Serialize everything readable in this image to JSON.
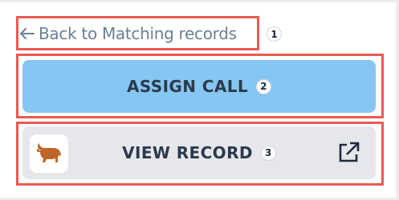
{
  "back_link": {
    "label": "Back to Matching records",
    "icon": "arrow-left-icon",
    "annotation": "1"
  },
  "assign_call": {
    "label": "ASSIGN CALL",
    "annotation": "2",
    "color": "#86c6f2"
  },
  "view_record": {
    "label": "VIEW RECORD",
    "annotation": "3",
    "logo_icon": "bull-logo-icon",
    "action_icon": "external-link-icon",
    "color": "#e6e7eb"
  },
  "highlight_color": "#ea5a52"
}
